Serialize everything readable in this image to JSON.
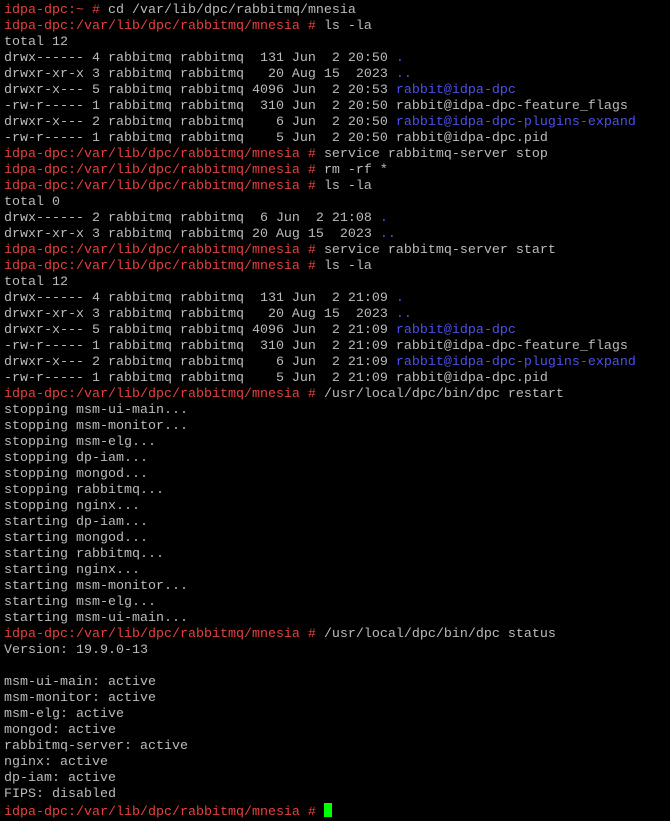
{
  "colors": {
    "prompt": "#e8403f",
    "dir": "#4f4fe8",
    "text": "#bbbbbb",
    "cursor": "#00ff00"
  },
  "lines": [
    [
      [
        "p",
        "idpa-dpc:~ # "
      ],
      [
        "n",
        "cd /var/lib/dpc/rabbitmq/mnesia"
      ]
    ],
    [
      [
        "p",
        "idpa-dpc:/var/lib/dpc/rabbitmq/mnesia # "
      ],
      [
        "n",
        "ls -la"
      ]
    ],
    [
      [
        "n",
        "total 12"
      ]
    ],
    [
      [
        "n",
        "drwx------ 4 rabbitmq rabbitmq  131 Jun  2 20:50 "
      ],
      [
        "b",
        "."
      ]
    ],
    [
      [
        "n",
        "drwxr-xr-x 3 rabbitmq rabbitmq   20 Aug 15  2023 "
      ],
      [
        "b",
        ".."
      ]
    ],
    [
      [
        "n",
        "drwxr-x--- 5 rabbitmq rabbitmq 4096 Jun  2 20:53 "
      ],
      [
        "b",
        "rabbit@idpa-dpc"
      ]
    ],
    [
      [
        "n",
        "-rw-r----- 1 rabbitmq rabbitmq  310 Jun  2 20:50 rabbit@idpa-dpc-feature_flags"
      ]
    ],
    [
      [
        "n",
        "drwxr-x--- 2 rabbitmq rabbitmq    6 Jun  2 20:50 "
      ],
      [
        "b",
        "rabbit@idpa-dpc-plugins-expand"
      ]
    ],
    [
      [
        "n",
        "-rw-r----- 1 rabbitmq rabbitmq    5 Jun  2 20:50 rabbit@idpa-dpc.pid"
      ]
    ],
    [
      [
        "p",
        "idpa-dpc:/var/lib/dpc/rabbitmq/mnesia # "
      ],
      [
        "n",
        "service rabbitmq-server stop"
      ]
    ],
    [
      [
        "p",
        "idpa-dpc:/var/lib/dpc/rabbitmq/mnesia # "
      ],
      [
        "n",
        "rm -rf *"
      ]
    ],
    [
      [
        "p",
        "idpa-dpc:/var/lib/dpc/rabbitmq/mnesia # "
      ],
      [
        "n",
        "ls -la"
      ]
    ],
    [
      [
        "n",
        "total 0"
      ]
    ],
    [
      [
        "n",
        "drwx------ 2 rabbitmq rabbitmq  6 Jun  2 21:08 "
      ],
      [
        "b",
        "."
      ]
    ],
    [
      [
        "n",
        "drwxr-xr-x 3 rabbitmq rabbitmq 20 Aug 15  2023 "
      ],
      [
        "b",
        ".."
      ]
    ],
    [
      [
        "p",
        "idpa-dpc:/var/lib/dpc/rabbitmq/mnesia # "
      ],
      [
        "n",
        "service rabbitmq-server start"
      ]
    ],
    [
      [
        "p",
        "idpa-dpc:/var/lib/dpc/rabbitmq/mnesia # "
      ],
      [
        "n",
        "ls -la"
      ]
    ],
    [
      [
        "n",
        "total 12"
      ]
    ],
    [
      [
        "n",
        "drwx------ 4 rabbitmq rabbitmq  131 Jun  2 21:09 "
      ],
      [
        "b",
        "."
      ]
    ],
    [
      [
        "n",
        "drwxr-xr-x 3 rabbitmq rabbitmq   20 Aug 15  2023 "
      ],
      [
        "b",
        ".."
      ]
    ],
    [
      [
        "n",
        "drwxr-x--- 5 rabbitmq rabbitmq 4096 Jun  2 21:09 "
      ],
      [
        "b",
        "rabbit@idpa-dpc"
      ]
    ],
    [
      [
        "n",
        "-rw-r----- 1 rabbitmq rabbitmq  310 Jun  2 21:09 rabbit@idpa-dpc-feature_flags"
      ]
    ],
    [
      [
        "n",
        "drwxr-x--- 2 rabbitmq rabbitmq    6 Jun  2 21:09 "
      ],
      [
        "b",
        "rabbit@idpa-dpc-plugins-expand"
      ]
    ],
    [
      [
        "n",
        "-rw-r----- 1 rabbitmq rabbitmq    5 Jun  2 21:09 rabbit@idpa-dpc.pid"
      ]
    ],
    [
      [
        "p",
        "idpa-dpc:/var/lib/dpc/rabbitmq/mnesia # "
      ],
      [
        "n",
        "/usr/local/dpc/bin/dpc restart"
      ]
    ],
    [
      [
        "n",
        "stopping msm-ui-main..."
      ]
    ],
    [
      [
        "n",
        "stopping msm-monitor..."
      ]
    ],
    [
      [
        "n",
        "stopping msm-elg..."
      ]
    ],
    [
      [
        "n",
        "stopping dp-iam..."
      ]
    ],
    [
      [
        "n",
        "stopping mongod..."
      ]
    ],
    [
      [
        "n",
        "stopping rabbitmq..."
      ]
    ],
    [
      [
        "n",
        "stopping nginx..."
      ]
    ],
    [
      [
        "n",
        "starting dp-iam..."
      ]
    ],
    [
      [
        "n",
        "starting mongod..."
      ]
    ],
    [
      [
        "n",
        "starting rabbitmq..."
      ]
    ],
    [
      [
        "n",
        "starting nginx..."
      ]
    ],
    [
      [
        "n",
        "starting msm-monitor..."
      ]
    ],
    [
      [
        "n",
        "starting msm-elg..."
      ]
    ],
    [
      [
        "n",
        "starting msm-ui-main..."
      ]
    ],
    [
      [
        "p",
        "idpa-dpc:/var/lib/dpc/rabbitmq/mnesia # "
      ],
      [
        "n",
        "/usr/local/dpc/bin/dpc status"
      ]
    ],
    [
      [
        "n",
        "Version: 19.9.0-13"
      ]
    ],
    [
      [
        "n",
        ""
      ]
    ],
    [
      [
        "n",
        "msm-ui-main: active"
      ]
    ],
    [
      [
        "n",
        "msm-monitor: active"
      ]
    ],
    [
      [
        "n",
        "msm-elg: active"
      ]
    ],
    [
      [
        "n",
        "mongod: active"
      ]
    ],
    [
      [
        "n",
        "rabbitmq-server: active"
      ]
    ],
    [
      [
        "n",
        "nginx: active"
      ]
    ],
    [
      [
        "n",
        "dp-iam: active"
      ]
    ],
    [
      [
        "n",
        "FIPS: disabled"
      ]
    ],
    [
      [
        "p",
        "idpa-dpc:/var/lib/dpc/rabbitmq/mnesia # "
      ]
    ]
  ]
}
